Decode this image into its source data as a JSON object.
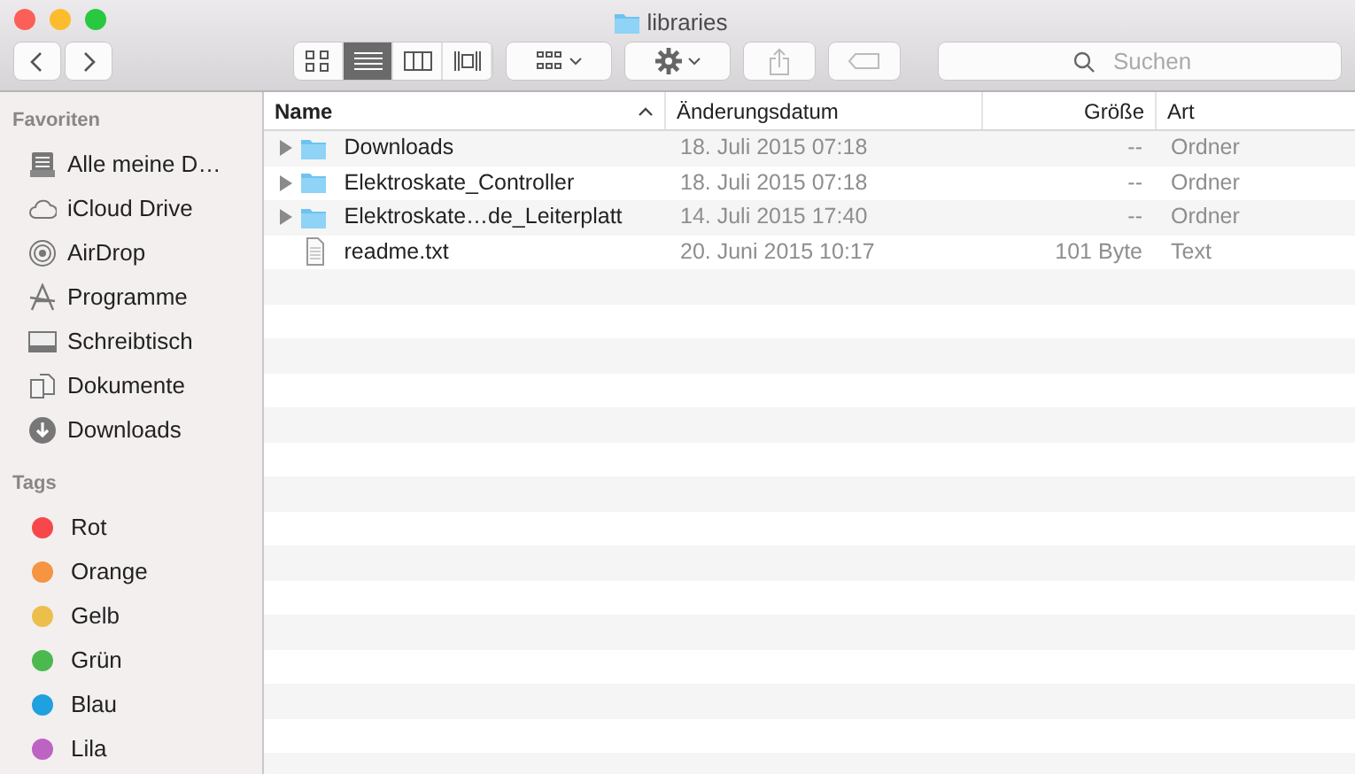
{
  "window": {
    "title": "libraries"
  },
  "toolbar": {
    "view_modes": [
      {
        "selected": false
      },
      {
        "selected": true
      },
      {
        "selected": false
      },
      {
        "selected": false
      }
    ],
    "search": {
      "placeholder": "Suchen"
    }
  },
  "sidebar": {
    "sections": [
      {
        "heading": "Favoriten",
        "items": [
          {
            "label": "Alle meine D…"
          },
          {
            "label": "iCloud Drive"
          },
          {
            "label": "AirDrop"
          },
          {
            "label": "Programme"
          },
          {
            "label": "Schreibtisch"
          },
          {
            "label": "Dokumente"
          },
          {
            "label": "Downloads"
          }
        ]
      },
      {
        "heading": "Tags",
        "items": [
          {
            "label": "Rot",
            "color": "#f6484b"
          },
          {
            "label": "Orange",
            "color": "#f59441"
          },
          {
            "label": "Gelb",
            "color": "#ecbf4d"
          },
          {
            "label": "Grün",
            "color": "#4cb94f"
          },
          {
            "label": "Blau",
            "color": "#1fa0df"
          },
          {
            "label": "Lila",
            "color": "#bd63c4"
          }
        ]
      }
    ]
  },
  "table": {
    "columns": [
      {
        "label": "Name",
        "sorted": true
      },
      {
        "label": "Änderungsdatum",
        "sorted": false
      },
      {
        "label": "Größe",
        "sorted": false
      },
      {
        "label": "Art",
        "sorted": false
      }
    ],
    "rows": [
      {
        "kind": "folder",
        "name": "Downloads",
        "date": "18. Juli 2015 07:18",
        "size": "--",
        "type": "Ordner"
      },
      {
        "kind": "folder",
        "name": "Elektroskate_Controller",
        "date": "18. Juli 2015 07:18",
        "size": "--",
        "type": "Ordner"
      },
      {
        "kind": "folder",
        "name": "Elektroskate…de_Leiterplatt",
        "date": "14. Juli 2015 17:40",
        "size": "--",
        "type": "Ordner"
      },
      {
        "kind": "file",
        "name": "readme.txt",
        "date": "20. Juni 2015 10:17",
        "size": "101 Byte",
        "type": "Text"
      }
    ]
  }
}
